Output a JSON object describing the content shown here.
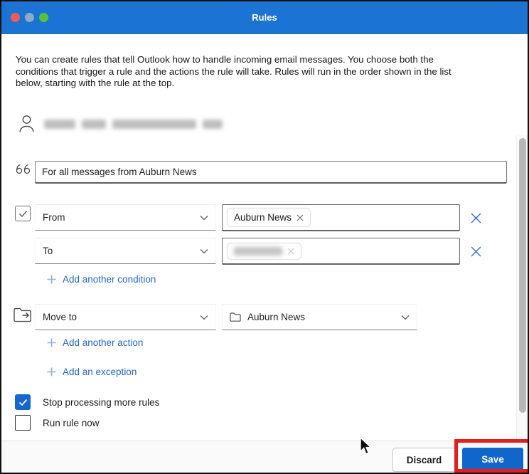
{
  "window": {
    "title": "Rules"
  },
  "intro": "You can create rules that tell Outlook how to handle incoming email messages. You choose both the conditions that trigger a rule and the actions the rule will take. Rules will run in the order shown in the list below, starting with the rule at the top.",
  "account": {
    "email_redacted": true
  },
  "rule_name": {
    "value": "For all messages from Auburn News"
  },
  "conditions": {
    "enabled_checkbox_checked": true,
    "rows": [
      {
        "field": "From",
        "tag": "Auburn News"
      },
      {
        "field": "To",
        "tag_redacted": true
      }
    ],
    "add_label": "Add another condition"
  },
  "action": {
    "field": "Move to",
    "folder": "Auburn News",
    "add_label": "Add another action",
    "exception_label": "Add an exception"
  },
  "options": {
    "stop_processing": {
      "label": "Stop processing more rules",
      "checked": true
    },
    "run_now": {
      "label": "Run rule now",
      "checked": false
    }
  },
  "footer": {
    "discard_label": "Discard",
    "save_label": "Save"
  },
  "icons": {
    "account": "person-icon",
    "rule_name": "quote-icon",
    "dropdown": "chevron-down-icon",
    "remove_tag": "x-small-icon",
    "remove_condition": "x-icon",
    "add": "plus-icon",
    "move_to": "folder-move-icon",
    "folder": "folder-icon",
    "checked": "checkmark-icon",
    "pointer": "mouse-cursor"
  },
  "colors": {
    "titlebar_blue": "#1b73d4",
    "save_blue": "#1166cb",
    "checkbox_blue": "#1566d0",
    "link_blue": "#2767c5",
    "delete_x_blue": "#2e6fd6",
    "annotation_red": "#e41d1d"
  }
}
